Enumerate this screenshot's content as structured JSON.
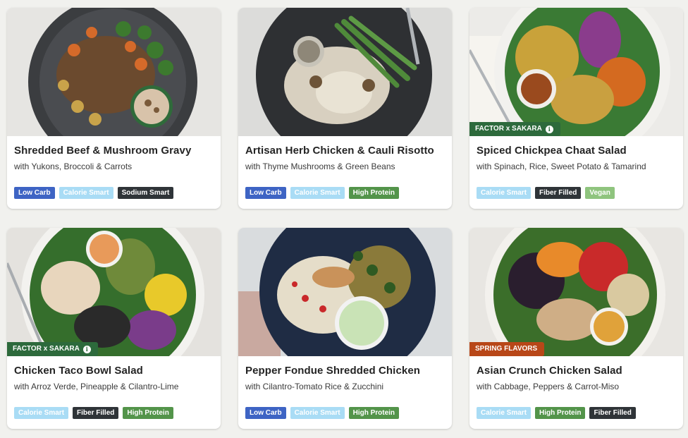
{
  "meals": [
    {
      "title": "Shredded Beef & Mushroom Gravy",
      "subtitle": "with Yukons, Broccoli & Carrots",
      "tags": [
        "Low Carb",
        "Calorie Smart",
        "Sodium Smart"
      ],
      "ribbon": ""
    },
    {
      "title": "Artisan Herb Chicken & Cauli Risotto",
      "subtitle": "with Thyme Mushrooms & Green Beans",
      "tags": [
        "Low Carb",
        "Calorie Smart",
        "High Protein"
      ],
      "ribbon": ""
    },
    {
      "title": "Spiced Chickpea Chaat Salad",
      "subtitle": "with Spinach, Rice, Sweet Potato & Tamarind",
      "tags": [
        "Calorie Smart",
        "Fiber Filled",
        "Vegan"
      ],
      "ribbon": "FACTOR x SAKARA"
    },
    {
      "title": "Chicken Taco Bowl Salad",
      "subtitle": "with Arroz Verde, Pineapple & Cilantro-Lime",
      "tags": [
        "Calorie Smart",
        "Fiber Filled",
        "High Protein"
      ],
      "ribbon": "FACTOR x SAKARA"
    },
    {
      "title": "Pepper Fondue Shredded Chicken",
      "subtitle": "with Cilantro-Tomato Rice & Zucchini",
      "tags": [
        "Low Carb",
        "Calorie Smart",
        "High Protein"
      ],
      "ribbon": ""
    },
    {
      "title": "Asian Crunch Chicken Salad",
      "subtitle": "with Cabbage, Peppers & Carrot-Miso",
      "tags": [
        "Calorie Smart",
        "High Protein",
        "Fiber Filled"
      ],
      "ribbon": "SPRING FLAVORS"
    }
  ],
  "icons": {
    "info": "info-icon"
  },
  "colors": {
    "low_carb": "#3e64c4",
    "calorie_smart": "#a9dcf5",
    "sodium_smart": "#2f3438",
    "high_protein": "#53944a",
    "fiber_filled": "#2f3438",
    "vegan": "#8fc47e",
    "ribbon_sakara": "#2d6a3c",
    "ribbon_spring": "#b84718"
  }
}
